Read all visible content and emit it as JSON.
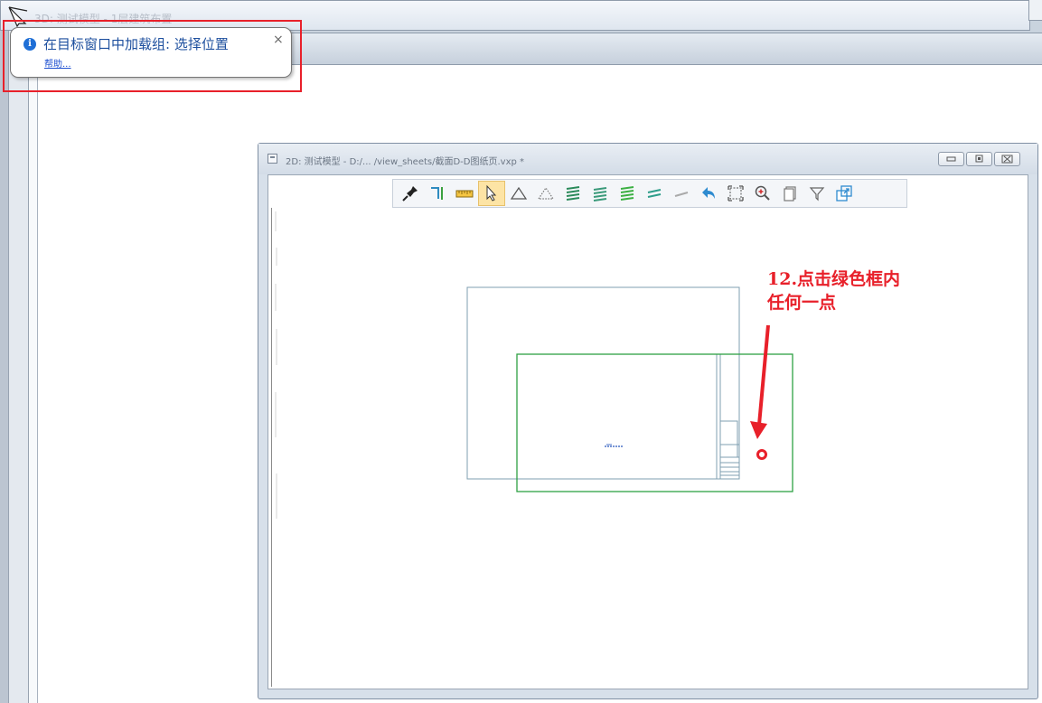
{
  "outer_window": {
    "title": "3D: 测试模型 - 1层建筑布置"
  },
  "notification": {
    "message": "在目标窗口中加载组: 选择位置",
    "help_link": "帮助...",
    "close": "×"
  },
  "window_2d": {
    "title": "2D: 测试模型 - D:/... /view_sheets/截面D-D图纸页.vxp *",
    "toolbar": [
      "pin-icon",
      "trim-icon",
      "ruler-icon",
      "select-arrow-icon",
      "triangle-icon",
      "dotted-triangle-icon",
      "layers-icon",
      "layers-alt-icon",
      "layers-green-icon",
      "layers-thin-icon",
      "line-icon",
      "undo-icon",
      "fit-view-icon",
      "zoom-in-icon",
      "copy-icon",
      "filter-icon",
      "window-restore-icon"
    ],
    "active_tool": "select-arrow-icon"
  },
  "annotation": {
    "line1": "12.点击绿色框内",
    "line2": "任何一点"
  },
  "colors": {
    "accent_red": "#e8202a",
    "green_box": "#2ea043",
    "drawing_blue": "#7f9fb0"
  }
}
